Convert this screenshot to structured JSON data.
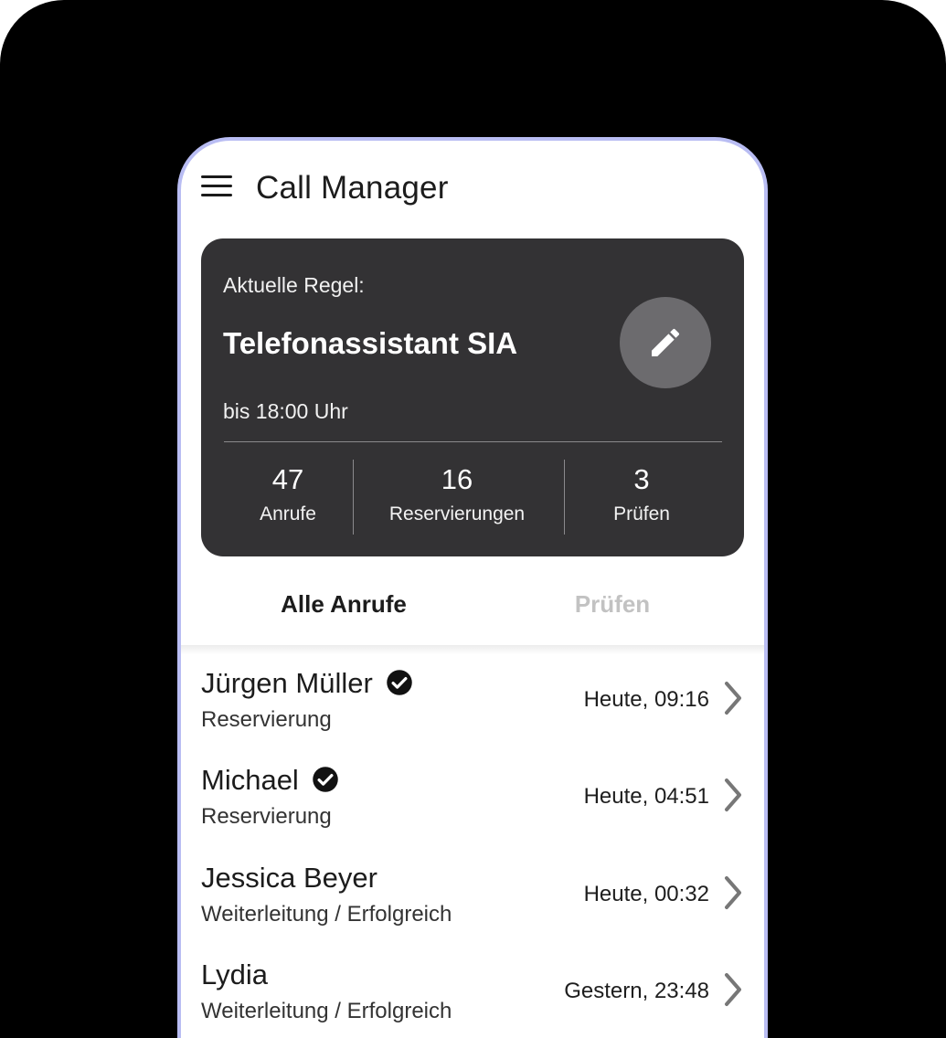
{
  "app": {
    "title": "Call Manager"
  },
  "rule_card": {
    "label": "Aktuelle Regel:",
    "name": "Telefonassistant SIA",
    "until": "bis 18:00 Uhr",
    "stats": [
      {
        "value": "47",
        "label": "Anrufe"
      },
      {
        "value": "16",
        "label": "Reservierungen"
      },
      {
        "value": "3",
        "label": "Prüfen"
      }
    ]
  },
  "tabs": [
    {
      "label": "Alle Anrufe",
      "active": true
    },
    {
      "label": "Prüfen",
      "active": false
    }
  ],
  "calls": [
    {
      "name": "Jürgen Müller",
      "verified": true,
      "status": "Reservierung",
      "time": "Heute, 09:16"
    },
    {
      "name": "Michael",
      "verified": true,
      "status": "Reservierung",
      "time": "Heute, 04:51"
    },
    {
      "name": "Jessica Beyer",
      "verified": false,
      "status": "Weiterleitung / Erfolgreich",
      "time": "Heute, 00:32"
    },
    {
      "name": "Lydia",
      "verified": false,
      "status": "Weiterleitung / Erfolgreich",
      "time": "Gestern, 23:48"
    }
  ],
  "icons": {
    "menu": "hamburger-menu-icon",
    "edit": "pencil-icon",
    "verified": "check-circle-icon",
    "row_action": "chevron-right-icon"
  },
  "colors": {
    "frame_border": "#b9bdf3",
    "card_background": "#333234",
    "edit_button": "#6c6b6e",
    "tab_inactive": "#c2c2c2"
  }
}
